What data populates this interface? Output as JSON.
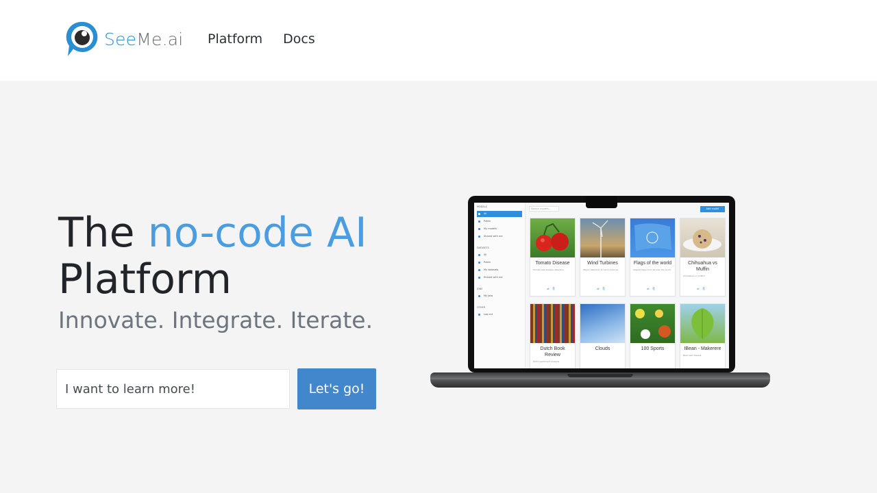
{
  "brand": {
    "see": "See",
    "me": "Me.ai",
    "logo_colors": {
      "ring": "#2a8fd0",
      "pupil": "#2b2b2b"
    }
  },
  "nav": {
    "items": [
      {
        "label": "Platform"
      },
      {
        "label": "Docs"
      }
    ]
  },
  "hero": {
    "title_prefix": "The",
    "title_accent": "no-code AI",
    "title_suffix": "Platform",
    "subtitle": "Innovate. Integrate. Iterate."
  },
  "cta": {
    "input_value": "I want to learn more!",
    "button_label": "Let's go!"
  },
  "colors": {
    "accent": "#4a9de0",
    "button": "#4287cc",
    "background": "#f4f4f5"
  },
  "screen": {
    "sidebar": {
      "sections": [
        {
          "header": "MODELS",
          "items": [
            "All",
            "Public",
            "My models",
            "Shared with me"
          ]
        },
        {
          "header": "DATASETS",
          "items": [
            "All",
            "Public",
            "My datasets",
            "Shared with me"
          ]
        },
        {
          "header": "JOBS",
          "items": [
            "My jobs"
          ]
        },
        {
          "header": "OTHER",
          "items": [
            "Log out"
          ]
        }
      ]
    },
    "search_placeholder": "Search models...",
    "add_button": "Add model",
    "cards": [
      {
        "title": "Tomato Disease",
        "desc": "Tomato leaf disease detection"
      },
      {
        "title": "Wind Turbines",
        "desc": "Object detection for wind turbines"
      },
      {
        "title": "Flags of the world",
        "desc": "Classify flags from all over the world"
      },
      {
        "title": "Chihuahua vs Muffin",
        "desc": "Chihuahua or muffin?"
      },
      {
        "title": "Dutch Book Review",
        "desc": "Dutch sentiment analysis"
      },
      {
        "title": "Clouds",
        "desc": ""
      },
      {
        "title": "100 Sports",
        "desc": ""
      },
      {
        "title": "IBean - Makerere",
        "desc": "Bean leaf disease"
      }
    ]
  }
}
